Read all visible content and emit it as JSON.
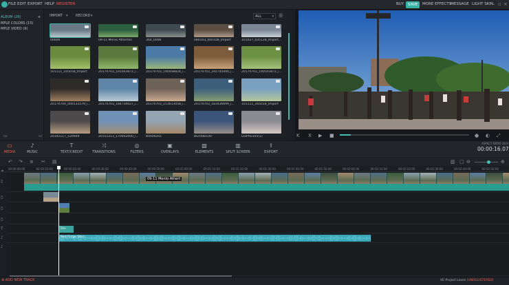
{
  "menubar": {
    "items": [
      "FILE",
      "EDIT",
      "EXPORT",
      "HELP"
    ],
    "register": "REGISTER",
    "right_items": [
      "BUY",
      "SAVE",
      "MORE EFFECTS",
      "MESSAGE",
      "LIGHT SKIN"
    ]
  },
  "album": {
    "items": [
      "ALBUM (26)",
      "MPLE COLORS (15)",
      "MPLE VIDEO (9)"
    ]
  },
  "library": {
    "import_label": "IMPORT",
    "record_label": "RECORD",
    "filter_value": "ALL",
    "thumbs": [
      {
        "label": "00006",
        "colors": [
          "#6a7886",
          "#b9c7cf"
        ]
      },
      {
        "label": "09-11 Menio Atherton",
        "colors": [
          "#2d5e3d",
          "#79a968"
        ]
      },
      {
        "label": "360_0008",
        "colors": [
          "#3e4a52",
          "#8d8f8a"
        ]
      },
      {
        "label": "080103_000108_Import",
        "colors": [
          "#5b4e44",
          "#b1998a"
        ]
      },
      {
        "label": "101027_035128_Import...",
        "colors": [
          "#7c8796",
          "#c8d0d4"
        ]
      },
      {
        "label": "101111_165018_Import",
        "colors": [
          "#6a8b3d",
          "#a4c16b"
        ]
      },
      {
        "label": "20170703_191003872_i...",
        "colors": [
          "#59793d",
          "#8fb86b"
        ]
      },
      {
        "label": "20170703_190448824_i...",
        "colors": [
          "#4a7aa5",
          "#9ab57a"
        ]
      },
      {
        "label": "20170703_192745000_i...",
        "colors": [
          "#7d5c3c",
          "#c8a07a"
        ]
      },
      {
        "label": "20170703_190503872_i...",
        "colors": [
          "#6d9143",
          "#a3c37a"
        ]
      },
      {
        "label": "20170704_000133579_i...",
        "colors": [
          "#2d2a28",
          "#a07e62"
        ]
      },
      {
        "label": "20170703_184730027_i...",
        "colors": [
          "#5f86a8",
          "#b8c9d6"
        ]
      },
      {
        "label": "20170703_153613058_i...",
        "colors": [
          "#6f6258",
          "#c9a98e"
        ]
      },
      {
        "label": "20170703_183436699_i...",
        "colors": [
          "#3d5f7c",
          "#889e72"
        ]
      },
      {
        "label": "101111_165018_Import",
        "colors": [
          "#7aa0c0",
          "#b5c79a"
        ]
      },
      {
        "label": "20141117_120949",
        "colors": [
          "#4c4a4a",
          "#b89c82"
        ]
      },
      {
        "label": "20151213_170402000_i...",
        "colors": [
          "#6f91b8",
          "#a59073"
        ]
      },
      {
        "label": "B0000201",
        "colors": [
          "#93a4b3",
          "#a38767"
        ]
      },
      {
        "label": "BIZHUB100",
        "colors": [
          "#3a547a",
          "#9a8d86"
        ]
      },
      {
        "label": "GOPR0105(1)",
        "colors": [
          "#8a8a92",
          "#d8c9c4"
        ]
      }
    ]
  },
  "preview": {
    "controls": [
      "K",
      "X",
      "▶",
      "■"
    ]
  },
  "tools": [
    {
      "label": "MEDIA",
      "icon": "▭"
    },
    {
      "label": "MUSIC",
      "icon": "♪"
    },
    {
      "label": "TEXT/CREDIT",
      "icon": "T"
    },
    {
      "label": "TRANSITIONS",
      "icon": "⤨"
    },
    {
      "label": "FILTERS",
      "icon": "◎"
    },
    {
      "label": "OVERLAYS",
      "icon": "▣"
    },
    {
      "label": "ELEMENTS",
      "icon": "▨"
    },
    {
      "label": "SPLIT SCREEN",
      "icon": "▥"
    },
    {
      "label": "EXPORT",
      "icon": "⇪"
    }
  ],
  "status": {
    "ratio": "ASPECT RATIO 16:9",
    "timecode": "00:00:16.07"
  },
  "ruler": [
    "00:00:00:00",
    "00:00:10:00",
    "00:00:20:00",
    "00:00:30:00",
    "00:00:40:00",
    "00:00:50:00",
    "00:01:00:00",
    "00:01:10:00",
    "00:01:20:00",
    "00:01:30:00",
    "00:01:40:00",
    "00:01:50:00",
    "00:02:00:00",
    "00:02:10:00",
    "00:02:20:00",
    "00:02:30:00",
    "00:02:40:00",
    "00:02:50:00"
  ],
  "timeline": {
    "clip_title": "09-11 Menlo Athert",
    "text_clip": "Title",
    "audio_clip": "Red Ridge Stori"
  },
  "bottom": {
    "add_track": "ADD NEW TRACK",
    "project_info": "VE Project Loose",
    "project_info_tag": "(UNREGISTERED)"
  }
}
